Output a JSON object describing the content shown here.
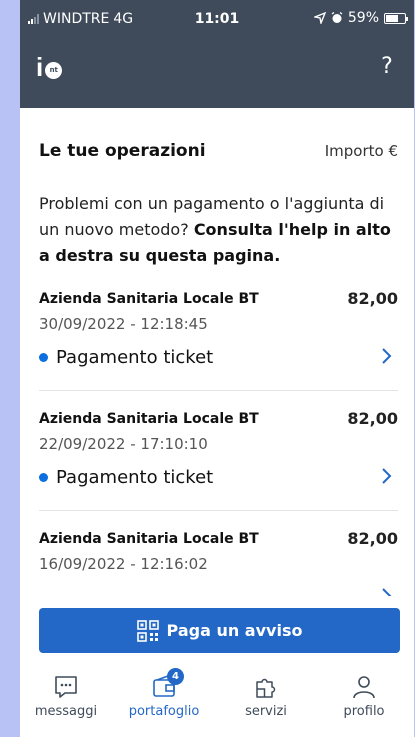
{
  "status_bar": {
    "carrier": "WINDTRE",
    "network": "4G",
    "time": "11:01",
    "battery": "59%"
  },
  "header": {
    "logo_badge": "nt",
    "help_label": "?"
  },
  "list": {
    "title": "Le tue operazioni",
    "amount_label": "Importo €"
  },
  "help": {
    "text_plain": "Problemi con un pagamento o l'aggiunta di un nuovo metodo?",
    "text_bold": "Consulta l'help in alto a destra su questa pagina."
  },
  "transactions": [
    {
      "merchant": "Azienda Sanitaria Locale BT",
      "amount": "82,00",
      "date": "30/09/2022 - 12:18:45",
      "label": "Pagamento ticket"
    },
    {
      "merchant": "Azienda Sanitaria Locale BT",
      "amount": "82,00",
      "date": "22/09/2022 - 17:10:10",
      "label": "Pagamento ticket"
    },
    {
      "merchant": "Azienda Sanitaria Locale BT",
      "amount": "82,00",
      "date": "16/09/2022 - 12:16:02",
      "label": ""
    }
  ],
  "pay_button": {
    "label": "Paga un avviso"
  },
  "tabbar": {
    "items": [
      {
        "label": "messaggi",
        "icon": "chat-icon"
      },
      {
        "label": "portafoglio",
        "icon": "wallet-icon",
        "badge": "4"
      },
      {
        "label": "servizi",
        "icon": "puzzle-icon"
      },
      {
        "label": "profilo",
        "icon": "person-icon"
      }
    ]
  },
  "colors": {
    "header_bg": "#3f4b5a",
    "accent": "#2468c7",
    "status_dot": "#0b6fe0",
    "page_bg": "#b9c2f5"
  }
}
